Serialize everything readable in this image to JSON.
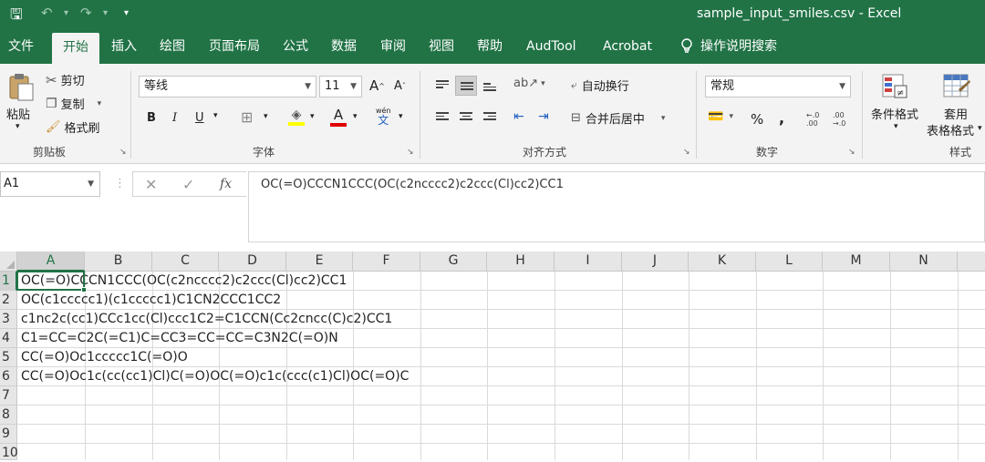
{
  "titlebar": {
    "document_title": "sample_input_smiles.csv  -  Excel",
    "save_glyph": "🖫",
    "undo_glyph": "↶",
    "redo_glyph": "↷",
    "menu_glyph": "▾"
  },
  "tabs": [
    "文件",
    "开始",
    "插入",
    "绘图",
    "页面布局",
    "公式",
    "数据",
    "审阅",
    "视图",
    "帮助",
    "AudTool",
    "Acrobat"
  ],
  "tell_me": "操作说明搜索",
  "ribbon": {
    "clipboard": {
      "paste": "粘贴",
      "cut": "剪切",
      "copy": "复制",
      "format_painter": "格式刷",
      "group": "剪贴板"
    },
    "font": {
      "name": "等线",
      "size": "11",
      "grow": "A",
      "shrink": "A",
      "bold": "B",
      "italic": "I",
      "underline": "U",
      "wen": "wén",
      "wen_char": "文",
      "group": "字体"
    },
    "alignment": {
      "wrap": "自动换行",
      "merge": "合并后居中",
      "group": "对齐方式"
    },
    "number": {
      "format": "常规",
      "percent": "%",
      "comma": ",",
      "inc": "←.0\n.00",
      "dec": ".00\n→.0",
      "group": "数字"
    },
    "styles": {
      "conditional": "条件格式",
      "table_format_1": "套用",
      "table_format_2": "表格格式",
      "group": "样式"
    },
    "accent": "#217346"
  },
  "formula_bar": {
    "name_box": "A1",
    "cancel": "✕",
    "enter": "✓",
    "fx": "fx",
    "content": "OC(=O)CCCN1CCC(OC(c2ncccc2)c2ccc(Cl)cc2)CC1"
  },
  "sheet": {
    "columns": [
      "A",
      "B",
      "C",
      "D",
      "E",
      "F",
      "G",
      "H",
      "I",
      "J",
      "K",
      "L",
      "M",
      "N"
    ],
    "rows": [
      "1",
      "2",
      "3",
      "4",
      "5",
      "6",
      "7",
      "8",
      "9",
      "10"
    ],
    "cells": [
      "OC(=O)CCCN1CCC(OC(c2ncccc2)c2ccc(Cl)cc2)CC1",
      "OC(c1ccccc1)(c1ccccc1)C1CN2CCC1CC2",
      "c1nc2c(cc1)CCc1cc(Cl)ccc1C2=C1CCN(Cc2cncc(C)c2)CC1",
      "C1=CC=C2C(=C1)C=CC3=CC=CC=C3N2C(=O)N",
      "CC(=O)Oc1ccccc1C(=O)O",
      "CC(=O)Oc1c(cc(cc1)Cl)C(=O)OC(=O)c1c(ccc(c1)Cl)OC(=O)C"
    ]
  }
}
